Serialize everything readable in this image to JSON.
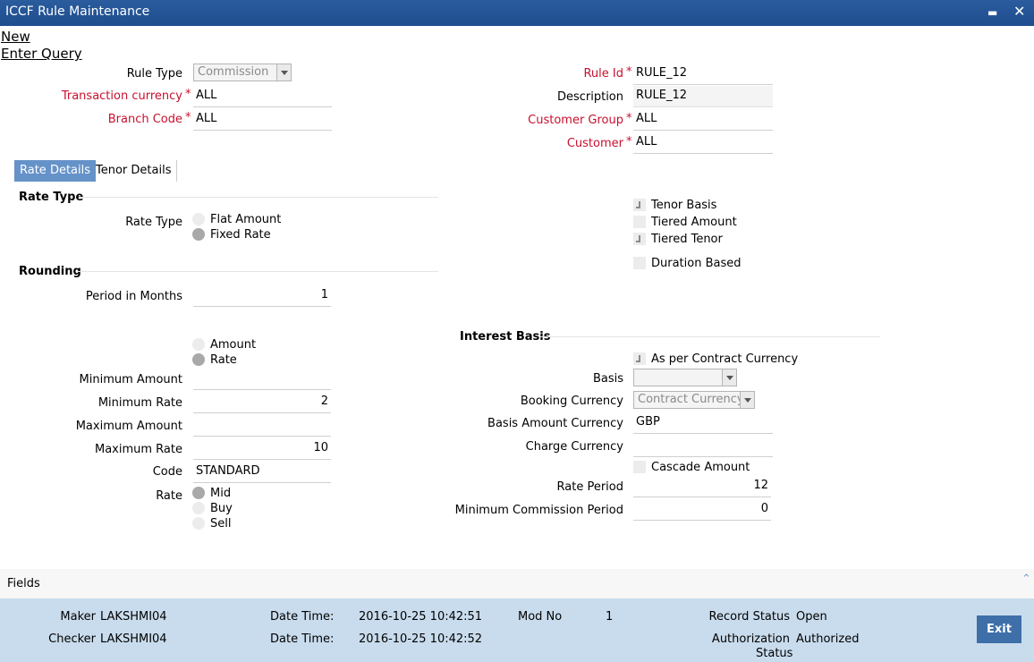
{
  "window": {
    "title": "ICCF Rule Maintenance",
    "minimize": "▬",
    "close": "✕"
  },
  "menu": {
    "new": "New",
    "enter_query": "Enter Query"
  },
  "header": {
    "rule_type_label": "Rule Type",
    "rule_type_value": "Commission",
    "txn_currency_label": "Transaction currency",
    "txn_currency_value": "ALL",
    "branch_code_label": "Branch Code",
    "branch_code_value": "ALL",
    "rule_id_label": "Rule Id",
    "rule_id_value": "RULE_12",
    "description_label": "Description",
    "description_value": "RULE_12",
    "customer_group_label": "Customer Group",
    "customer_group_value": "ALL",
    "customer_label": "Customer",
    "customer_value": "ALL",
    "required_mark": "*"
  },
  "tabs": {
    "rate_details": "Rate Details",
    "tenor_details": "Tenor Details"
  },
  "rate_type": {
    "section": "Rate Type",
    "label": "Rate Type",
    "options": [
      "Flat Amount",
      "Fixed Rate"
    ],
    "selected": "Fixed Rate"
  },
  "checks": {
    "tenor_basis": "Tenor Basis",
    "tiered_amount": "Tiered Amount",
    "tiered_tenor": "Tiered Tenor",
    "duration_based": "Duration Based"
  },
  "rounding": {
    "section": "Rounding",
    "period_label": "Period in Months",
    "period_value": "1",
    "options": [
      "Amount",
      "Rate"
    ],
    "selected": "Rate",
    "min_amount_label": "Minimum Amount",
    "min_amount_value": "",
    "min_rate_label": "Minimum Rate",
    "min_rate_value": "2",
    "max_amount_label": "Maximum Amount",
    "max_amount_value": "",
    "max_rate_label": "Maximum Rate",
    "max_rate_value": "10",
    "code_label": "Code",
    "code_value": "STANDARD",
    "rate_label": "Rate",
    "rate_options": [
      "Mid",
      "Buy",
      "Sell"
    ],
    "rate_selected": "Mid"
  },
  "interest": {
    "section": "Interest Basis",
    "as_per_contract": "As per Contract Currency",
    "basis_label": "Basis",
    "basis_value": "",
    "booking_label": "Booking Currency",
    "booking_value": "Contract Currency",
    "basis_amount_label": "Basis Amount Currency",
    "basis_amount_value": "GBP",
    "charge_label": "Charge Currency",
    "charge_value": "",
    "cascade": "Cascade Amount",
    "rate_period_label": "Rate Period",
    "rate_period_value": "12",
    "min_comm_label": "Minimum Commission Period",
    "min_comm_value": "0"
  },
  "fields_bar": {
    "label": "Fields",
    "toggle": "⌃"
  },
  "footer": {
    "maker_label": "Maker",
    "maker_value": "LAKSHMI04",
    "checker_label": "Checker",
    "checker_value": "LAKSHMI04",
    "dt_label": "Date Time:",
    "maker_dt": "2016-10-25 10:42:51",
    "checker_dt": "2016-10-25 10:42:52",
    "mod_label": "Mod No",
    "mod_value": "1",
    "record_label": "Record Status",
    "record_value": "Open",
    "auth_label_1": "Authorization",
    "auth_label_2": "Status",
    "auth_value": "Authorized",
    "exit": "Exit"
  }
}
